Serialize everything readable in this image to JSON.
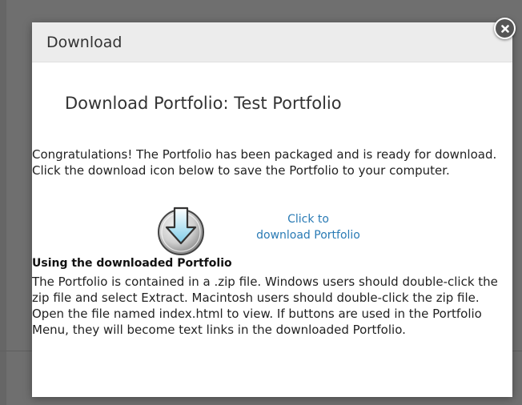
{
  "modal": {
    "title": "Download",
    "heading": "Download Portfolio: Test Portfolio",
    "intro": "Congratulations! The Portfolio has been packaged and is ready for download. Click the download icon below to save the Portfolio to your computer.",
    "download_link_line1": "Click to",
    "download_link_line2": "download Portfolio",
    "usage_heading": "Using the downloaded Portfolio",
    "usage_text": "The Portfolio is contained in a .zip file. Windows users should double-click the zip file and select Extract. Macintosh users should double-click the zip file. Open the file named index.html to view. If buttons are used in the Portfolio Menu, they will become text links in the downloaded Portfolio."
  },
  "icons": {
    "close": "close-icon",
    "download": "download-arrow-icon"
  },
  "colors": {
    "overlay": "#6f6f6f",
    "header_bg": "#ececec",
    "link": "#2a7bb5",
    "arrow_fill": "#8fd3ee",
    "close_bg": "#555555"
  }
}
